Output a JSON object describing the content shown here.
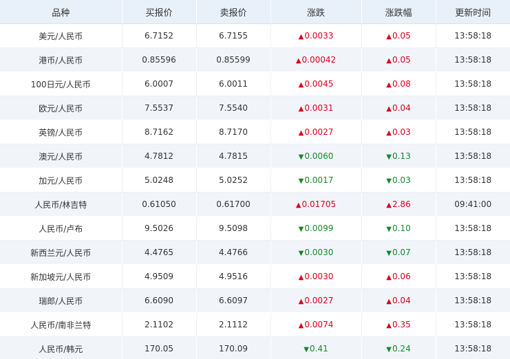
{
  "table": {
    "headers": [
      "品种",
      "买报价",
      "卖报价",
      "涨跌",
      "涨跌幅",
      "更新时间"
    ],
    "rows": [
      {
        "name": "美元/人民币",
        "buy": "6.7152",
        "sell": "6.7155",
        "dir": "up",
        "change": "0.0033",
        "pct": "0.05",
        "time": "13:58:18"
      },
      {
        "name": "港币/人民币",
        "buy": "0.85596",
        "sell": "0.85599",
        "dir": "up",
        "change": "0.00042",
        "pct": "0.05",
        "time": "13:58:18"
      },
      {
        "name": "100日元/人民币",
        "buy": "6.0007",
        "sell": "6.0011",
        "dir": "up",
        "change": "0.0045",
        "pct": "0.08",
        "time": "13:58:18"
      },
      {
        "name": "欧元/人民币",
        "buy": "7.5537",
        "sell": "7.5540",
        "dir": "up",
        "change": "0.0031",
        "pct": "0.04",
        "time": "13:58:18"
      },
      {
        "name": "英镑/人民币",
        "buy": "8.7162",
        "sell": "8.7170",
        "dir": "up",
        "change": "0.0027",
        "pct": "0.03",
        "time": "13:58:18"
      },
      {
        "name": "澳元/人民币",
        "buy": "4.7812",
        "sell": "4.7815",
        "dir": "down",
        "change": "0.0060",
        "pct": "0.13",
        "time": "13:58:18"
      },
      {
        "name": "加元/人民币",
        "buy": "5.0248",
        "sell": "5.0252",
        "dir": "down",
        "change": "0.0017",
        "pct": "0.03",
        "time": "13:58:18"
      },
      {
        "name": "人民币/林吉特",
        "buy": "0.61050",
        "sell": "0.61700",
        "dir": "up",
        "change": "0.01705",
        "pct": "2.86",
        "time": "09:41:00"
      },
      {
        "name": "人民币/卢布",
        "buy": "9.5026",
        "sell": "9.5098",
        "dir": "down",
        "change": "0.0099",
        "pct": "0.10",
        "time": "13:58:18"
      },
      {
        "name": "新西兰元/人民币",
        "buy": "4.4765",
        "sell": "4.4766",
        "dir": "down",
        "change": "0.0030",
        "pct": "0.07",
        "time": "13:58:18"
      },
      {
        "name": "新加坡元/人民币",
        "buy": "4.9509",
        "sell": "4.9516",
        "dir": "up",
        "change": "0.0030",
        "pct": "0.06",
        "time": "13:58:18"
      },
      {
        "name": "瑞郎/人民币",
        "buy": "6.6090",
        "sell": "6.6097",
        "dir": "up",
        "change": "0.0027",
        "pct": "0.04",
        "time": "13:58:18"
      },
      {
        "name": "人民币/南非兰特",
        "buy": "2.1102",
        "sell": "2.1112",
        "dir": "up",
        "change": "0.0074",
        "pct": "0.35",
        "time": "13:58:18"
      },
      {
        "name": "人民币/韩元",
        "buy": "170.05",
        "sell": "170.09",
        "dir": "down",
        "change": "0.41",
        "pct": "0.24",
        "time": "13:58:18"
      }
    ]
  },
  "symbols": {
    "up": "▲",
    "down": "▼"
  },
  "colors": {
    "up": "#d9001b",
    "down": "#14892c",
    "header_bg": "#e8f0fa",
    "stripe_bg": "#f1f5fa"
  },
  "icons": {
    "up": "triangle-up-icon",
    "down": "triangle-down-icon"
  }
}
